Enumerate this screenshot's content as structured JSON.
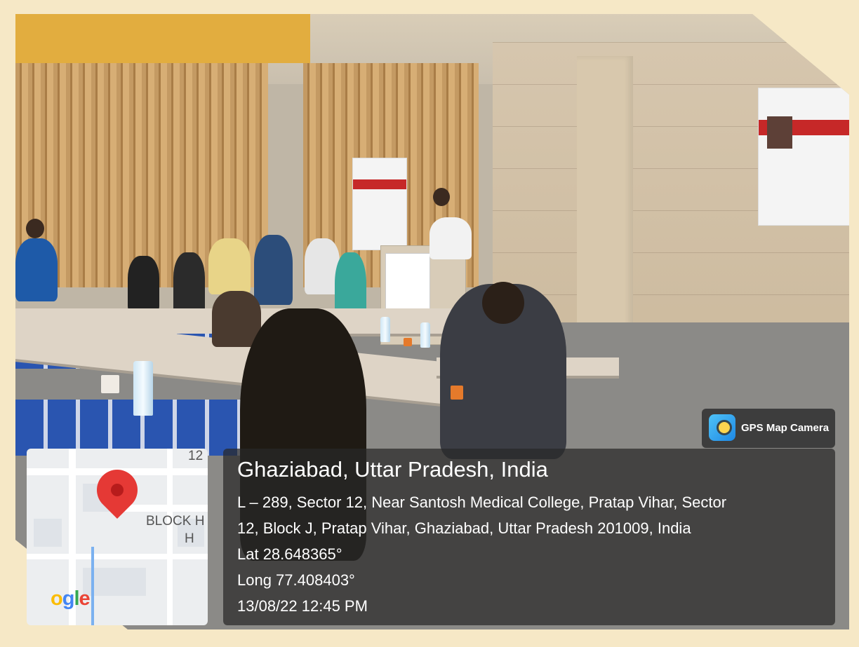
{
  "badge": {
    "app_name": "GPS Map Camera",
    "icon": "gps-camera-icon"
  },
  "location": {
    "title": "Ghaziabad, Uttar Pradesh, India",
    "address_line1": "L – 289, Sector 12, Near Santosh Medical College, Pratap Vihar, Sector",
    "address_line2": "12, Block J, Pratap Vihar, Ghaziabad, Uttar Pradesh 201009, India",
    "latitude": "Lat 28.648365°",
    "longitude": "Long 77.408403°",
    "timestamp": "13/08/22 12:45 PM"
  },
  "map": {
    "street_number": "12",
    "block_label": "BLOCK H",
    "block_label2": "H",
    "logo_text": "ogle",
    "pin_icon": "map-pin-icon"
  },
  "colors": {
    "pin": "#e53935",
    "overlay": "rgba(40,40,40,0.72)",
    "frame": "#f6e8c6"
  }
}
